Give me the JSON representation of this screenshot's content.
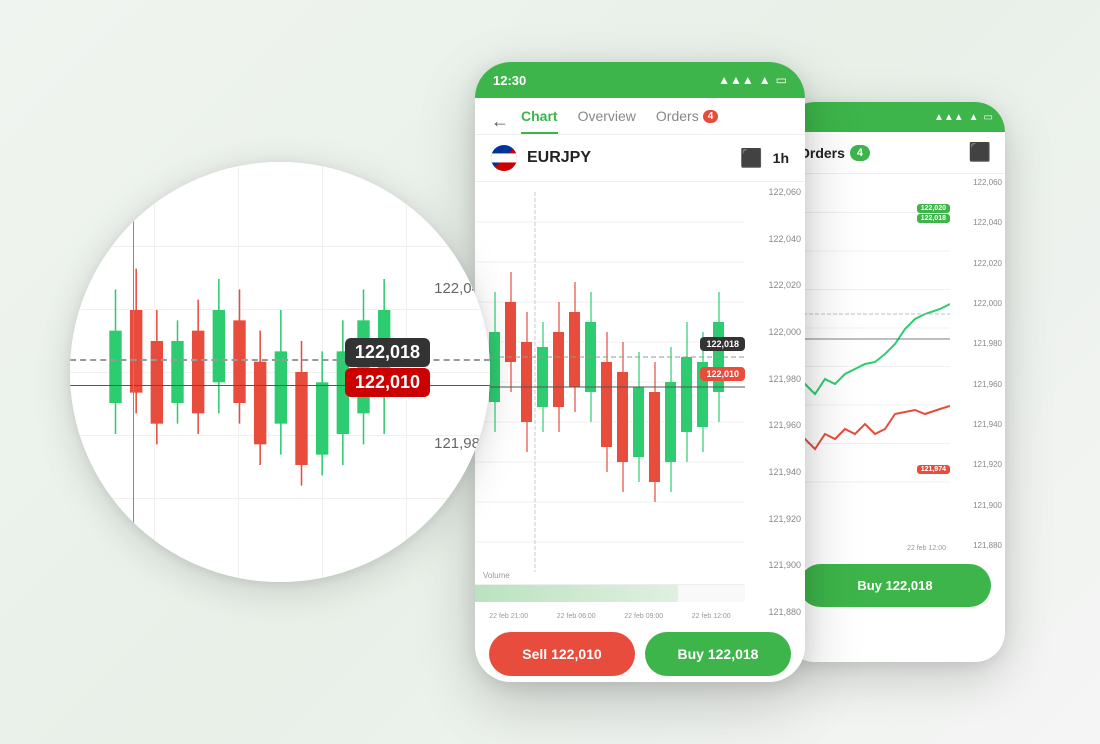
{
  "app": {
    "background": "#f0f4f0"
  },
  "phone_main": {
    "status_bar": {
      "time": "12:30",
      "signal": "▲▲▲",
      "wifi": "▲",
      "battery": "⬜"
    },
    "nav": {
      "back_label": "←",
      "tabs": [
        {
          "label": "Chart",
          "active": true
        },
        {
          "label": "Overview",
          "active": false
        },
        {
          "label": "Orders",
          "active": false,
          "badge": "4"
        }
      ]
    },
    "instrument": {
      "name": "EURJPY",
      "timeframe": "1h"
    },
    "chart": {
      "y_values": [
        "122,060",
        "122,040",
        "122,020",
        "122,000",
        "121,980",
        "121,960",
        "121,940",
        "121,920",
        "121,900",
        "121,880"
      ],
      "price_ask": "122,018",
      "price_bid": "122,010",
      "x_values": [
        "22 feb 21:00",
        "22 feb 06:00",
        "22 feb 09:00",
        "22 feb 12:00"
      ],
      "volume_label": "Volume"
    },
    "buttons": {
      "sell_label": "Sell 122,010",
      "buy_label": "Buy 122,018"
    }
  },
  "phone_secondary": {
    "header": {
      "title": "Orders",
      "badge": "4"
    },
    "chart": {
      "y_values": [
        "122,060",
        "122,040",
        "122,020",
        "122,000",
        "121,980",
        "121,960",
        "121,940",
        "121,920",
        "121,900",
        "121,880"
      ],
      "price_ask": "122,020\n122,018",
      "price_bid": "121,974",
      "x_label": "22 feb 12:00"
    },
    "button": {
      "buy_label": "Buy 122,018"
    }
  },
  "magnified": {
    "y_labels": [
      "122,04",
      "121,98"
    ],
    "price_ask": "122,018",
    "price_bid": "122,010"
  }
}
